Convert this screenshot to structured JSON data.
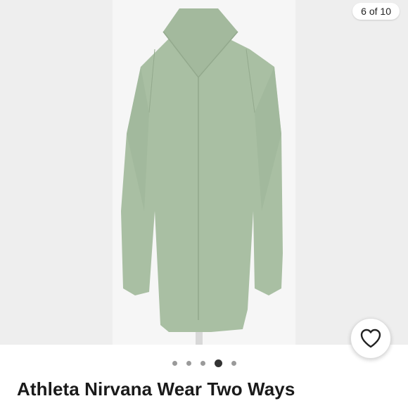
{
  "gallery": {
    "counter": "6 of 10",
    "total_images": 10,
    "current_index": 6,
    "indicator_dots": 5,
    "active_dot": 4
  },
  "listing": {
    "title": "Athleta Nirvana Wear Two Ways"
  },
  "colors": {
    "garment": "#a9bfa3",
    "background": "#f3f3f3"
  },
  "icons": {
    "like": "heart-icon"
  }
}
